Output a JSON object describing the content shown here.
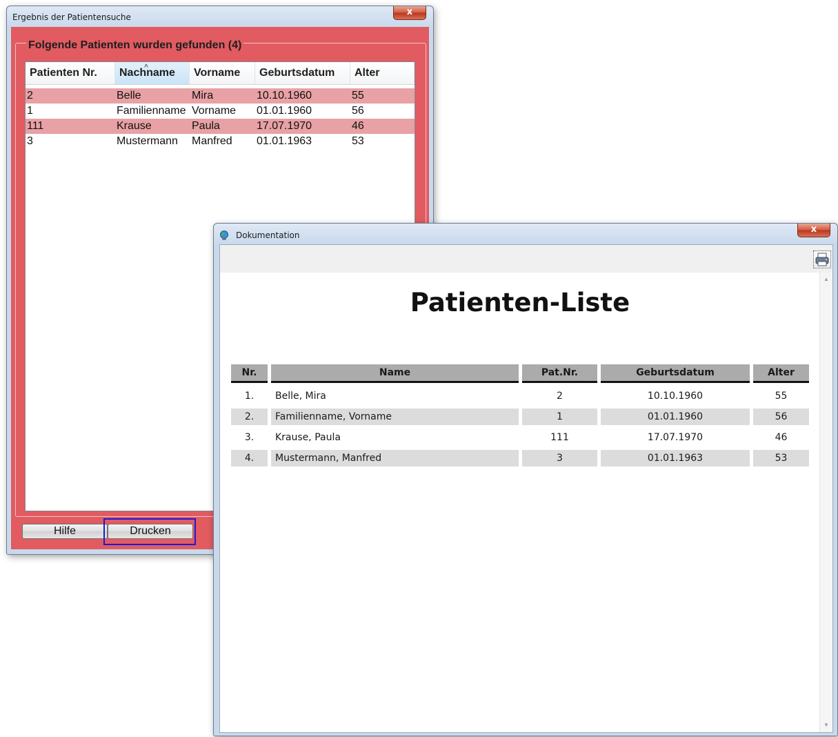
{
  "search_window": {
    "title": "Ergebnis der Patientensuche",
    "close_glyph": "x",
    "group_title": "Folgende Patienten wurden gefunden (4)",
    "columns": [
      "Patienten Nr.",
      "Nachname",
      "Vorname",
      "Geburtsdatum",
      "Alter"
    ],
    "sort_indicator": "^",
    "rows": [
      [
        "2",
        "Belle",
        "Mira",
        "10.10.1960",
        "55"
      ],
      [
        "1",
        "Familienname",
        "Vorname",
        "01.01.1960",
        "56"
      ],
      [
        "111",
        "Krause",
        "Paula",
        "17.07.1970",
        "46"
      ],
      [
        "3",
        "Mustermann",
        "Manfred",
        "01.01.1963",
        "53"
      ]
    ],
    "buttons": {
      "help": "Hilfe",
      "print": "Drucken"
    },
    "colors": {
      "frame": "#e15b61",
      "row_highlight": "#e8a1a4",
      "focus": "#1b19d6"
    }
  },
  "doc_window": {
    "title": "Dokumentation",
    "close_glyph": "x",
    "icons": {
      "window": "globe-icon",
      "toolbar": "printer-icon",
      "scroll_up": "chevron-up-icon",
      "scroll_down": "chevron-down-icon"
    },
    "scroll_up_glyph": "▲",
    "scroll_down_glyph": "▼",
    "heading": "Patienten-Liste",
    "columns": [
      "Nr.",
      "Name",
      "Pat.Nr.",
      "Geburtsdatum",
      "Alter"
    ],
    "rows": [
      [
        "1.",
        "Belle, Mira",
        "2",
        "10.10.1960",
        "55"
      ],
      [
        "2.",
        "Familienname, Vorname",
        "1",
        "01.01.1960",
        "56"
      ],
      [
        "3.",
        "Krause, Paula",
        "111",
        "17.07.1970",
        "46"
      ],
      [
        "4.",
        "Mustermann, Manfred",
        "3",
        "01.01.1963",
        "53"
      ]
    ]
  }
}
